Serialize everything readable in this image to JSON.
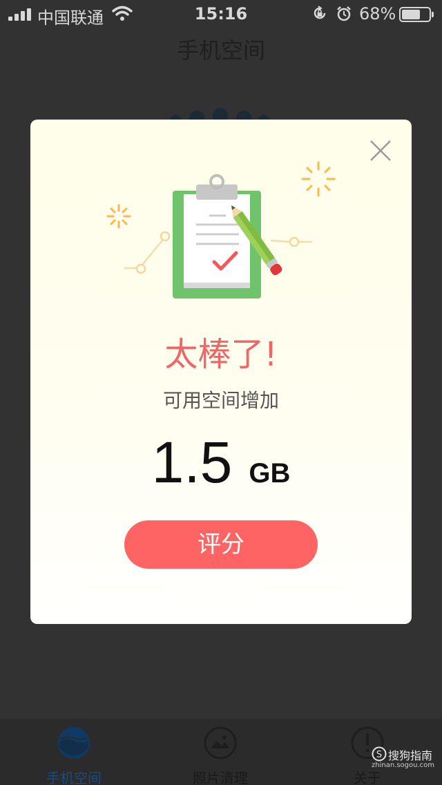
{
  "status_bar": {
    "carrier": "中国联通",
    "time": "15:16",
    "battery_percent": "68%",
    "battery_level": 0.68
  },
  "nav": {
    "title": "手机空间"
  },
  "modal": {
    "title": "太棒了!",
    "subtitle": "可用空间增加",
    "amount": "1.5",
    "unit": "GB",
    "button_label": "评分"
  },
  "tabs": [
    {
      "label": "手机空间",
      "icon": "phone-space-icon",
      "active": true
    },
    {
      "label": "照片清理",
      "icon": "photo-clean-icon",
      "active": false
    },
    {
      "label": "关于",
      "icon": "about-icon",
      "active": false
    }
  ],
  "watermark": {
    "text": "搜狗指南",
    "sub": "zhinan.sogou.com"
  },
  "colors": {
    "accent": "#ff6464",
    "title_red": "#f06565",
    "active_tab": "#1a4b80",
    "overlay": "#323232"
  }
}
